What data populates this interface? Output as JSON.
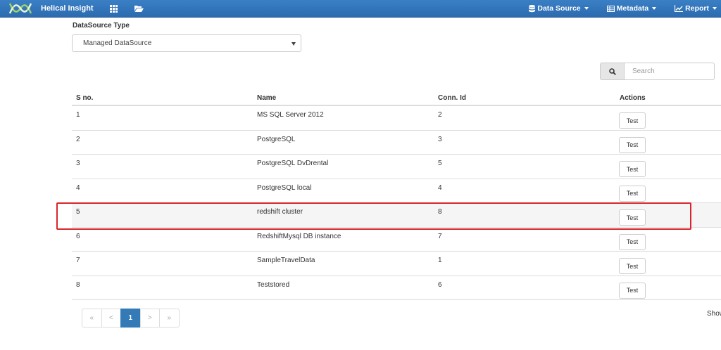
{
  "navbar": {
    "brand": "Helical Insight",
    "menus": [
      {
        "label": "Data Source",
        "icon": "database-icon"
      },
      {
        "label": "Metadata",
        "icon": "table-icon"
      },
      {
        "label": "Report",
        "icon": "line-chart-icon"
      }
    ]
  },
  "datasource": {
    "label": "DataSource Type",
    "selected": "Managed DataSource"
  },
  "search": {
    "placeholder": "Search"
  },
  "table": {
    "headers": [
      "S no.",
      "Name",
      "Conn. Id",
      "Actions"
    ],
    "rows": [
      {
        "sno": "1",
        "name": "MS SQL Server 2012",
        "conn": "2",
        "action": "Test"
      },
      {
        "sno": "2",
        "name": "PostgreSQL",
        "conn": "3",
        "action": "Test"
      },
      {
        "sno": "3",
        "name": "PostgreSQL DvDrental",
        "conn": "5",
        "action": "Test"
      },
      {
        "sno": "4",
        "name": "PostgreSQL local",
        "conn": "4",
        "action": "Test"
      },
      {
        "sno": "5",
        "name": "redshift cluster",
        "conn": "8",
        "action": "Test"
      },
      {
        "sno": "6",
        "name": "RedshiftMysql DB instance",
        "conn": "7",
        "action": "Test"
      },
      {
        "sno": "7",
        "name": "SampleTravelData",
        "conn": "1",
        "action": "Test"
      },
      {
        "sno": "8",
        "name": "Teststored",
        "conn": "6",
        "action": "Test"
      }
    ]
  },
  "pagination": {
    "items": [
      "«",
      "<",
      "1",
      ">",
      "»"
    ],
    "active": "1"
  },
  "footer": {
    "show_text": "Show"
  }
}
